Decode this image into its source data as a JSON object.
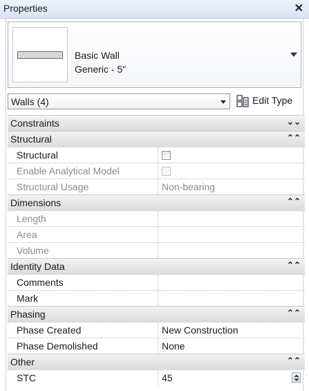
{
  "window": {
    "title": "Properties",
    "close": "✕"
  },
  "type_selector": {
    "family": "Basic Wall",
    "type": "Generic - 5\""
  },
  "filter": {
    "selected": "Walls (4)",
    "edit_type_label": "Edit Type"
  },
  "sections": [
    {
      "name": "Constraints",
      "chevron": "⌄⌄",
      "rows": []
    },
    {
      "name": "Structural",
      "chevron": "⌃⌃",
      "rows": [
        {
          "name": "Structural",
          "value": "",
          "kind": "checkbox",
          "disabled": false
        },
        {
          "name": "Enable Analytical Model",
          "value": "",
          "kind": "checkbox",
          "disabled": true
        },
        {
          "name": "Structural Usage",
          "value": "Non-bearing",
          "kind": "text",
          "disabled": true
        }
      ]
    },
    {
      "name": "Dimensions",
      "chevron": "⌃⌃",
      "rows": [
        {
          "name": "Length",
          "value": "",
          "kind": "text",
          "disabled": true
        },
        {
          "name": "Area",
          "value": "",
          "kind": "text",
          "disabled": true
        },
        {
          "name": "Volume",
          "value": "",
          "kind": "text",
          "disabled": true
        }
      ]
    },
    {
      "name": "Identity Data",
      "chevron": "⌃⌃",
      "rows": [
        {
          "name": "Comments",
          "value": "",
          "kind": "text",
          "disabled": false
        },
        {
          "name": "Mark",
          "value": "",
          "kind": "text",
          "disabled": false
        }
      ]
    },
    {
      "name": "Phasing",
      "chevron": "⌃⌃",
      "rows": [
        {
          "name": "Phase Created",
          "value": "New Construction",
          "kind": "text",
          "disabled": false
        },
        {
          "name": "Phase Demolished",
          "value": "None",
          "kind": "text",
          "disabled": false
        }
      ]
    },
    {
      "name": "Other",
      "chevron": "⌃⌃",
      "rows": [
        {
          "name": "STC",
          "value": "45",
          "kind": "spin",
          "disabled": false
        }
      ]
    }
  ]
}
